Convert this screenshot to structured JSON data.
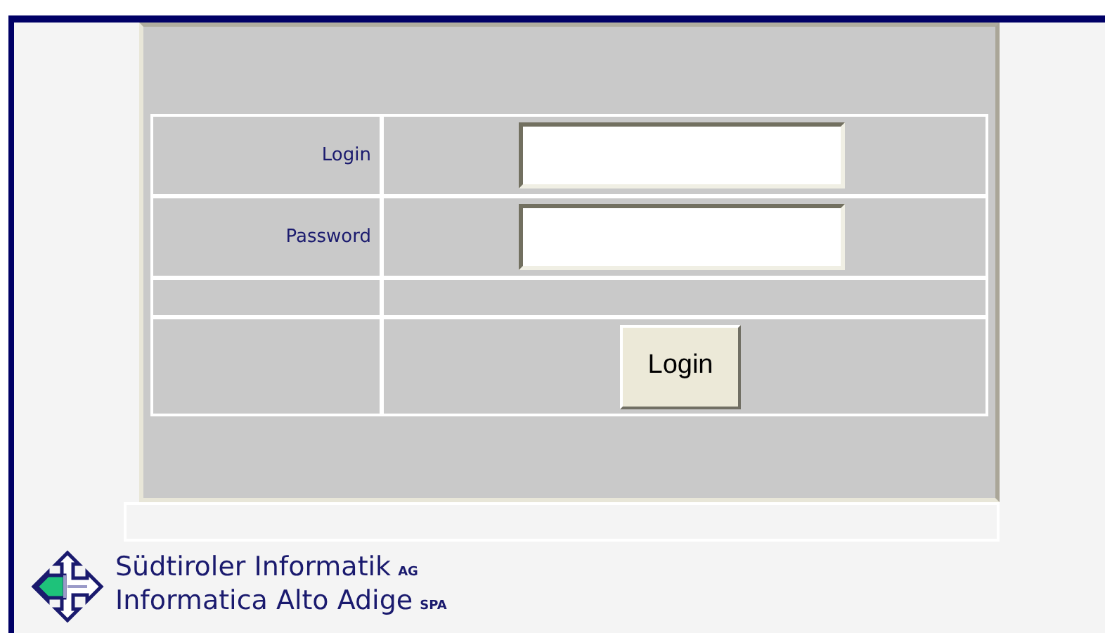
{
  "form": {
    "fields": [
      {
        "label": "Login"
      },
      {
        "label": "Password"
      }
    ],
    "button": "Login"
  },
  "logo": {
    "lines": [
      {
        "name": "Südtiroler Informatik",
        "suffix": "AG"
      },
      {
        "name": "Informatica Alto Adige",
        "suffix": "SPA"
      }
    ]
  }
}
